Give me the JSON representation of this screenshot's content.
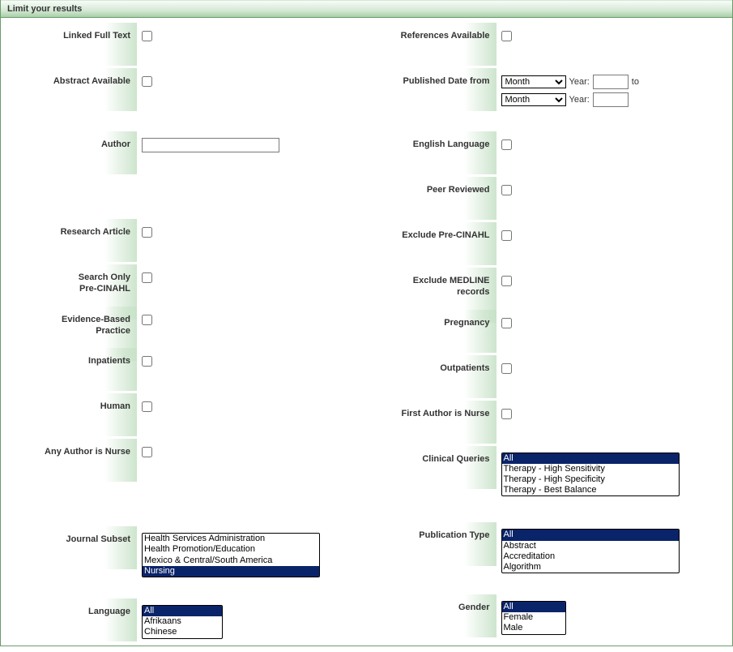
{
  "header": "Limit your results",
  "left": {
    "linked_full_text": "Linked Full Text",
    "abstract_available": "Abstract Available",
    "author": "Author",
    "research_article": "Research Article",
    "search_only_pre_cinahl_l1": "Search Only",
    "search_only_pre_cinahl_l2": "Pre-CINAHL",
    "evidence_based_l1": "Evidence-Based",
    "evidence_based_l2": "Practice",
    "inpatients": "Inpatients",
    "human": "Human",
    "any_author_nurse": "Any Author is Nurse",
    "journal_subset": "Journal Subset",
    "journal_subset_options": [
      "Health Services Administration",
      "Health Promotion/Education",
      "Mexico & Central/South America",
      "Nursing"
    ],
    "journal_subset_selected": "Nursing",
    "language": "Language",
    "language_options": [
      "All",
      "Afrikaans",
      "Chinese"
    ],
    "language_selected": "All"
  },
  "right": {
    "references_available": "References Available",
    "published_date_from": "Published Date from",
    "month_placeholder": "Month",
    "year_label": "Year:",
    "to_label": "to",
    "english_language": "English Language",
    "peer_reviewed": "Peer Reviewed",
    "exclude_pre_cinahl": "Exclude Pre-CINAHL",
    "exclude_medline_l1": "Exclude MEDLINE",
    "exclude_medline_l2": "records",
    "pregnancy": "Pregnancy",
    "outpatients": "Outpatients",
    "first_author_nurse": "First Author is Nurse",
    "clinical_queries": "Clinical Queries",
    "clinical_queries_options": [
      "All",
      "Therapy - High Sensitivity",
      "Therapy - High Specificity",
      "Therapy - Best Balance"
    ],
    "clinical_queries_selected": "All",
    "publication_type": "Publication Type",
    "publication_type_options": [
      "All",
      "Abstract",
      "Accreditation",
      "Algorithm"
    ],
    "publication_type_selected": "All",
    "gender": "Gender",
    "gender_options": [
      "All",
      "Female",
      "Male"
    ],
    "gender_selected": "All"
  }
}
